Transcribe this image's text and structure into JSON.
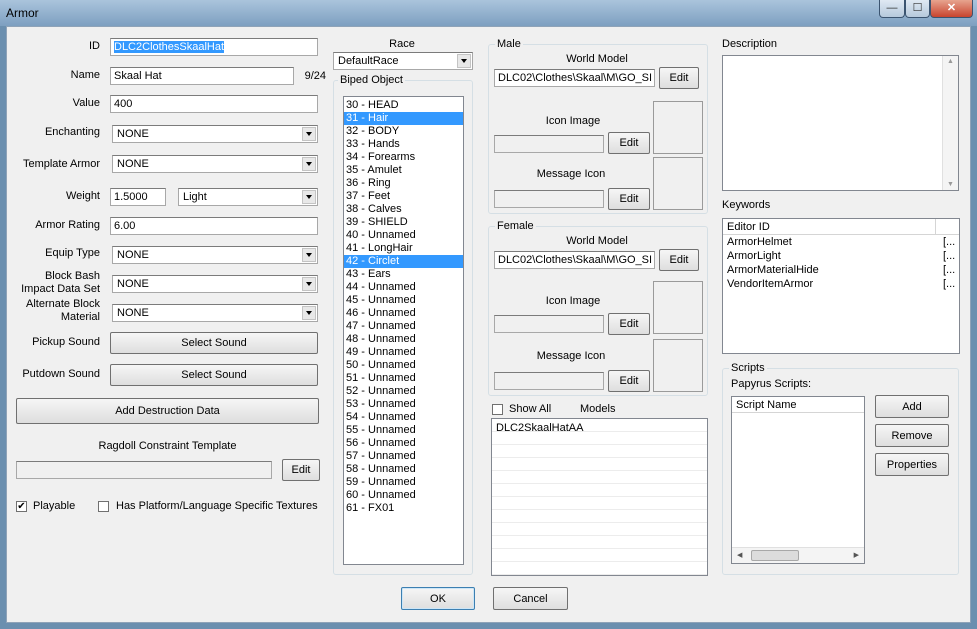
{
  "window": {
    "title": "Armor",
    "min": "—",
    "max": "☐",
    "close": "✕"
  },
  "form": {
    "id_label": "ID",
    "id_value": "DLC2ClothesSkaalHat",
    "name_label": "Name",
    "name_value": "Skaal Hat",
    "name_count": "9/24",
    "value_label": "Value",
    "value_value": "400",
    "enchanting_label": "Enchanting",
    "enchanting_value": "NONE",
    "template_label": "Template Armor",
    "template_value": "NONE",
    "weight_label": "Weight",
    "weight_value": "1.5000",
    "weight_class": "Light",
    "rating_label": "Armor Rating",
    "rating_value": "6.00",
    "equip_label": "Equip Type",
    "equip_value": "NONE",
    "blockbash_label": "Block Bash Impact Data Set",
    "blockbash_value": "NONE",
    "altblock_label": "Alternate Block Material",
    "altblock_value": "NONE",
    "pickup_label": "Pickup Sound",
    "pickup_button": "Select Sound",
    "putdown_label": "Putdown Sound",
    "putdown_button": "Select Sound",
    "destruction_button": "Add Destruction Data",
    "ragdoll_label": "Ragdoll Constraint Template",
    "ragdoll_edit": "Edit",
    "playable_label": "Playable",
    "playable_checked": true,
    "platform_label": "Has Platform/Language Specific Textures",
    "platform_checked": false
  },
  "race": {
    "label": "Race",
    "value": "DefaultRace"
  },
  "biped": {
    "label": "Biped Object",
    "items": [
      {
        "text": "30 - HEAD",
        "sel": false
      },
      {
        "text": "31 - Hair",
        "sel": true
      },
      {
        "text": "32 - BODY",
        "sel": false
      },
      {
        "text": "33 - Hands",
        "sel": false
      },
      {
        "text": "34 - Forearms",
        "sel": false
      },
      {
        "text": "35 - Amulet",
        "sel": false
      },
      {
        "text": "36 - Ring",
        "sel": false
      },
      {
        "text": "37 - Feet",
        "sel": false
      },
      {
        "text": "38 - Calves",
        "sel": false
      },
      {
        "text": "39 - SHIELD",
        "sel": false
      },
      {
        "text": "40 - Unnamed",
        "sel": false
      },
      {
        "text": "41 - LongHair",
        "sel": false
      },
      {
        "text": "42 - Circlet",
        "sel": true
      },
      {
        "text": "43 - Ears",
        "sel": false
      },
      {
        "text": "44 - Unnamed",
        "sel": false
      },
      {
        "text": "45 - Unnamed",
        "sel": false
      },
      {
        "text": "46 - Unnamed",
        "sel": false
      },
      {
        "text": "47 - Unnamed",
        "sel": false
      },
      {
        "text": "48 - Unnamed",
        "sel": false
      },
      {
        "text": "49 - Unnamed",
        "sel": false
      },
      {
        "text": "50 - Unnamed",
        "sel": false
      },
      {
        "text": "51 - Unnamed",
        "sel": false
      },
      {
        "text": "52 - Unnamed",
        "sel": false
      },
      {
        "text": "53 - Unnamed",
        "sel": false
      },
      {
        "text": "54 - Unnamed",
        "sel": false
      },
      {
        "text": "55 - Unnamed",
        "sel": false
      },
      {
        "text": "56 - Unnamed",
        "sel": false
      },
      {
        "text": "57 - Unnamed",
        "sel": false
      },
      {
        "text": "58 - Unnamed",
        "sel": false
      },
      {
        "text": "59 - Unnamed",
        "sel": false
      },
      {
        "text": "60 - Unnamed",
        "sel": false
      },
      {
        "text": "61 - FX01",
        "sel": false
      }
    ]
  },
  "male": {
    "label": "Male",
    "world_model_label": "World Model",
    "world_model_value": "DLC02\\Clothes\\Skaal\\M\\GO_SI",
    "edit": "Edit",
    "icon_label": "Icon Image",
    "icon_edit": "Edit",
    "msg_label": "Message Icon",
    "msg_edit": "Edit"
  },
  "female": {
    "label": "Female",
    "world_model_label": "World Model",
    "world_model_value": "DLC02\\Clothes\\Skaal\\M\\GO_SI",
    "edit": "Edit",
    "icon_label": "Icon Image",
    "icon_edit": "Edit",
    "msg_label": "Message Icon",
    "msg_edit": "Edit"
  },
  "models": {
    "show_all_label": "Show All",
    "show_all_checked": false,
    "label": "Models",
    "items": [
      "DLC2SkaalHatAA"
    ]
  },
  "description": {
    "label": "Description"
  },
  "keywords": {
    "label": "Keywords",
    "header": "Editor ID",
    "items": [
      {
        "id": "ArmorHelmet",
        "extra": "[..."
      },
      {
        "id": "ArmorLight",
        "extra": "[..."
      },
      {
        "id": "ArmorMaterialHide",
        "extra": "[..."
      },
      {
        "id": "VendorItemArmor",
        "extra": "[..."
      }
    ]
  },
  "scripts": {
    "label": "Scripts",
    "papyrus_label": "Papyrus Scripts:",
    "header": "Script Name",
    "add": "Add",
    "remove": "Remove",
    "properties": "Properties"
  },
  "footer": {
    "ok": "OK",
    "cancel": "Cancel"
  }
}
